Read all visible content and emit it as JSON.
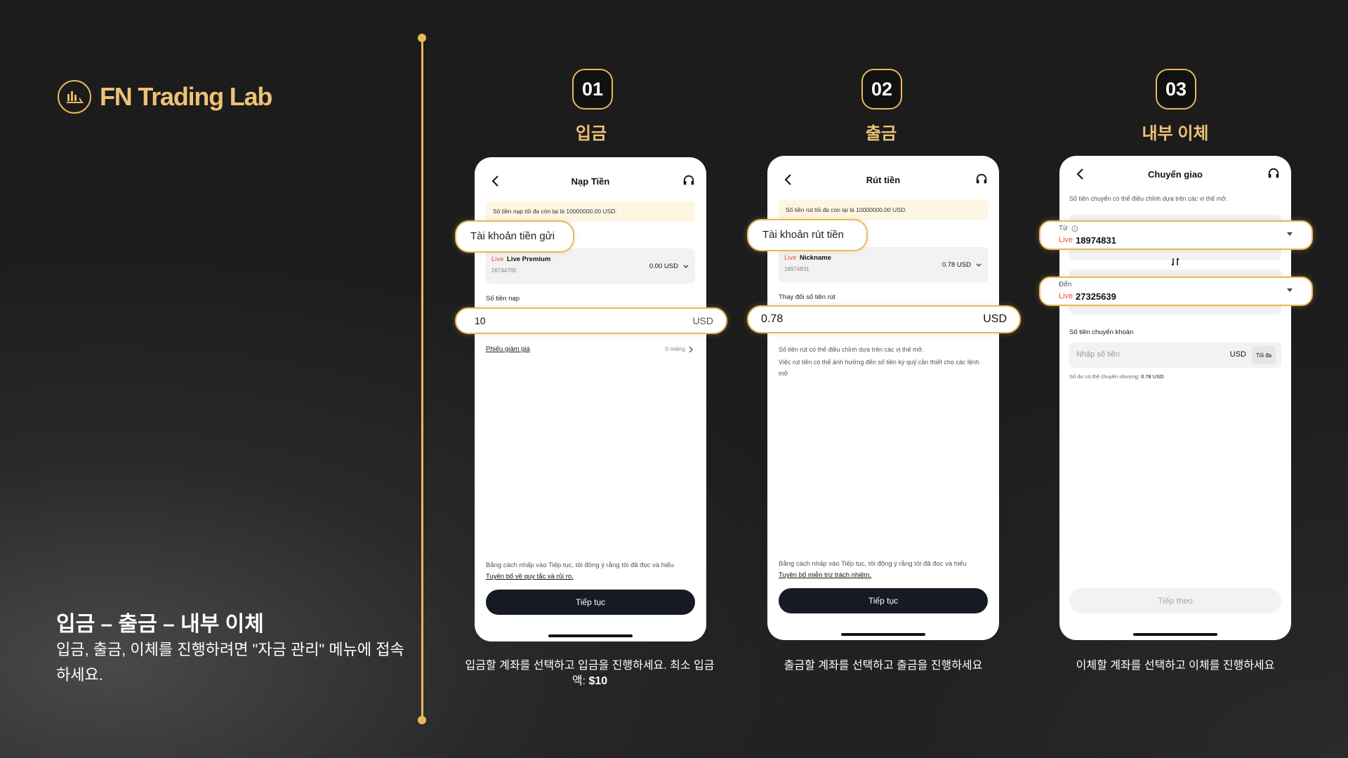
{
  "brand": {
    "name": "FN Trading Lab"
  },
  "left": {
    "title": "입금 – 출금 – 내부 이체",
    "desc": "입금, 출금, 이체를 진행하려면 \"자금 관리\" 메뉴에 접속하세요."
  },
  "colors": {
    "accent": "#e8b85c",
    "bg": "#1d1c1c",
    "live": "#e8513a",
    "button": "#151a23"
  },
  "steps": [
    {
      "num": "01",
      "title": "입금",
      "phone": {
        "header": "Nạp Tiền",
        "notice": "Số tiền nạp tối đa còn lại là 10000000.00 USD.",
        "pill_label": "Tài khoản tiền gửi",
        "account_tag": "Live",
        "account_name": "Live Premium",
        "account_id": "26744785",
        "account_balance": "0.00 USD",
        "amount_label": "Số tiền nạp",
        "amount_value": "10",
        "amount_unit": "USD",
        "coupon_label": "Phiếu giảm giá",
        "coupon_value": "0 miếng",
        "terms_line1": "Bằng cách nhấp vào Tiếp tục, tôi đồng ý rằng tôi đã đọc và hiểu",
        "terms_link": "Tuyên bố về quy tắc và rủi ro.",
        "button": "Tiếp tục"
      },
      "caption_main": "입금할 계좌를 선택하고 입금을 진행하세요. 최소 입금액: ",
      "caption_bold": "$10"
    },
    {
      "num": "02",
      "title": "출금",
      "phone": {
        "header": "Rút tiền",
        "notice": "Số tiền rút tối đa còn lại là 10000000.00 USD.",
        "pill_label": "Tài khoản rút tiền",
        "account_tag": "Live",
        "account_name": "Nickname",
        "account_id": "18974831",
        "account_balance": "0.78 USD",
        "amount_label": "Thay đổi số tiền rút",
        "amount_value": "0.78",
        "amount_unit": "USD",
        "info1": "Số tiền rút có thể điều chỉnh dựa trên các vị thế mở.",
        "info2": "Việc rút tiền có thể ảnh hưởng đến số tiền ký quỹ cần thiết cho các lệnh mở",
        "terms_line1": "Bằng cách nhấp vào Tiếp tục, tôi đồng ý rằng tôi đã đọc và hiểu",
        "terms_link": "Tuyên bố miễn trừ trách nhiệm.",
        "button": "Tiếp tục"
      },
      "caption_main": "출금할 계좌를 선택하고 출금을 진행하세요"
    },
    {
      "num": "03",
      "title": "내부 이체",
      "phone": {
        "header": "Chuyển giao",
        "notice": "Số tiền chuyển có thể điều chỉnh dựa trên các vị thế mở.",
        "from_label": "Từ",
        "from_tag": "Live",
        "from_id": "18974831",
        "to_label": "Đến",
        "to_tag": "Live",
        "to_id": "27325639",
        "amount_label": "Số tiền chuyển khoản",
        "amount_placeholder": "Nhập số tiền",
        "amount_unit": "USD",
        "max_label": "Tối đa",
        "available": "Số dư có thể chuyển nhượng: ",
        "available_value": "0.78 USD",
        "button": "Tiếp theo"
      },
      "caption_main": "이체할 계좌를 선택하고 이체를 진행하세요"
    }
  ]
}
